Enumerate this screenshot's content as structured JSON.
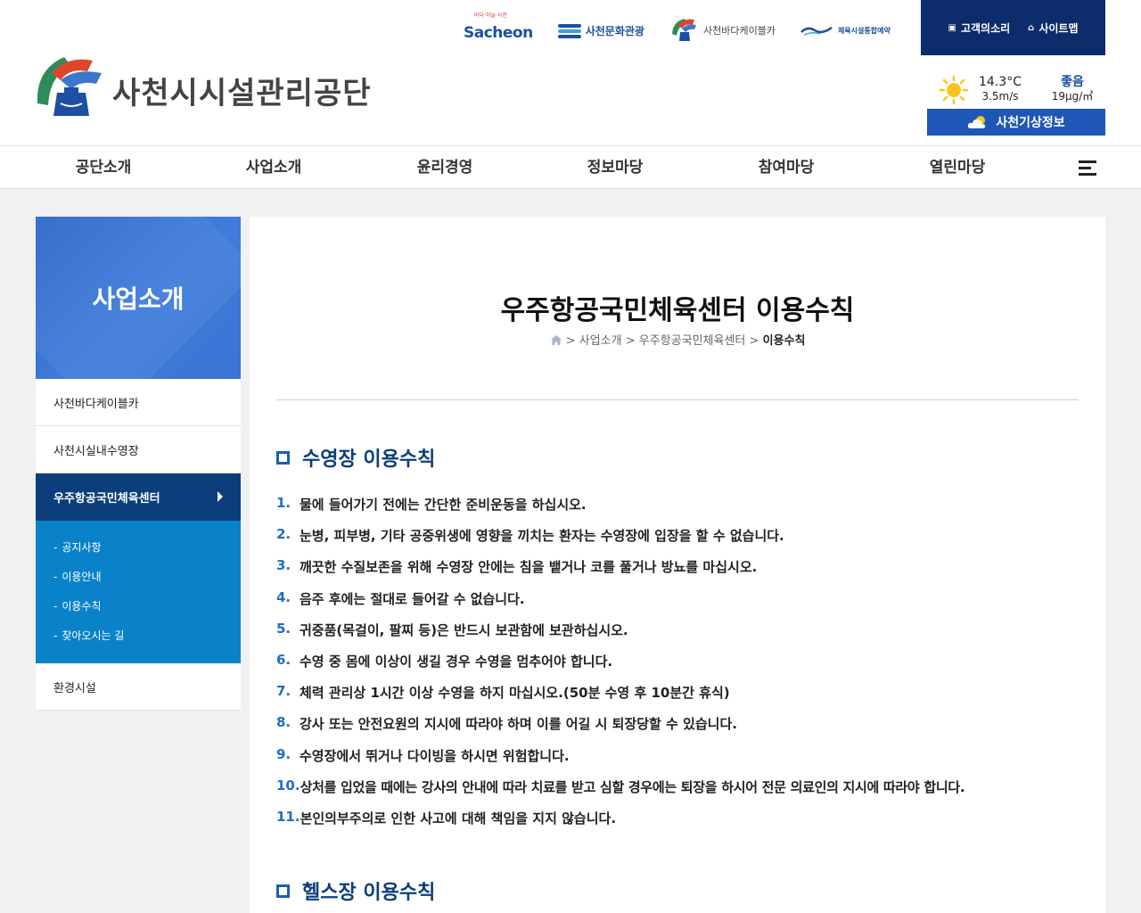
{
  "header": {
    "partners": {
      "sacheon_sub": "바다·하늘·사천",
      "sacheon": "Sacheon",
      "culture": "사천문화관광",
      "cable": "사천바다케이블카",
      "sports": "체육시설통합예약"
    },
    "util": {
      "voice": "고객의소리",
      "sitemap": "사이트맵"
    },
    "logo_text": "사천시시설관리공단",
    "weather": {
      "temp": "14.3°C",
      "wind": "3.5m/s",
      "air_status": "좋음",
      "air_value": "19μg/㎥",
      "button": "사천기상정보"
    }
  },
  "gnb": [
    "공단소개",
    "사업소개",
    "윤리경영",
    "정보마당",
    "참여마당",
    "열린마당"
  ],
  "lnb": {
    "title": "사업소개",
    "items": [
      {
        "label": "사천바다케이블카"
      },
      {
        "label": "사천시실내수영장"
      },
      {
        "label": "우주항공국민체육센터"
      },
      {
        "label": "환경시설"
      }
    ],
    "sub": [
      "공지사항",
      "이용안내",
      "이용수칙",
      "찾아오시는 길"
    ]
  },
  "content": {
    "title": "우주항공국민체육센터 이용수칙",
    "breadcrumb": {
      "sep": ">",
      "path1": "사업소개",
      "path2": "우주항공국민체육센터",
      "current": "이용수칙"
    },
    "sections": [
      {
        "title": "수영장 이용수칙",
        "rules": [
          {
            "num": "1.",
            "text": "물에 들어가기 전에는 간단한 준비운동을 하십시오."
          },
          {
            "num": "2.",
            "text": "눈병, 피부병, 기타 공중위생에 영향을 끼치는 환자는 수영장에 입장을 할 수 없습니다."
          },
          {
            "num": "3.",
            "text": "깨끗한 수질보존을 위해 수영장 안에는 침을 뱉거나 코를 풀거나 방뇨를 마십시오."
          },
          {
            "num": "4.",
            "text": "음주 후에는 절대로 들어갈 수 없습니다."
          },
          {
            "num": "5.",
            "text": "귀중품(목걸이, 팔찌 등)은 반드시 보관함에 보관하십시오."
          },
          {
            "num": "6.",
            "text": "수영 중 몸에 이상이 생길 경우 수영을 멈추어야 합니다."
          },
          {
            "num": "7.",
            "text": "체력 관리상 1시간 이상 수영을 하지 마십시오.(50분 수영 후 10분간 휴식)"
          },
          {
            "num": "8.",
            "text": "강사 또는 안전요원의 지시에 따라야 하며 이를 어길 시 퇴장당할 수 있습니다."
          },
          {
            "num": "9.",
            "text": "수영장에서 뛰거나 다이빙을 하시면 위험합니다."
          },
          {
            "num": "10.",
            "text": "상처를 입었을 때에는 강사의 안내에 따라 치료를 받고 심할 경우에는 퇴장을 하시어 전문 의료인의 지시에 따라야 합니다."
          },
          {
            "num": "11.",
            "text": "본인의부주의로 인한 사고에 대해 책임을 지지 않습니다."
          }
        ]
      },
      {
        "title": "헬스장 이용수칙"
      }
    ]
  },
  "colors": {
    "navy": "#0c3e7c",
    "util_bg": "#0d2c6b",
    "blue": "#1f57b6",
    "sub_blue": "#0a82c9",
    "number": "#1f6ec5"
  },
  "icons": [
    "home-icon",
    "sun-icon",
    "cloud-icon",
    "hamburger-icon",
    "chevron-right-icon",
    "memo-icon"
  ]
}
